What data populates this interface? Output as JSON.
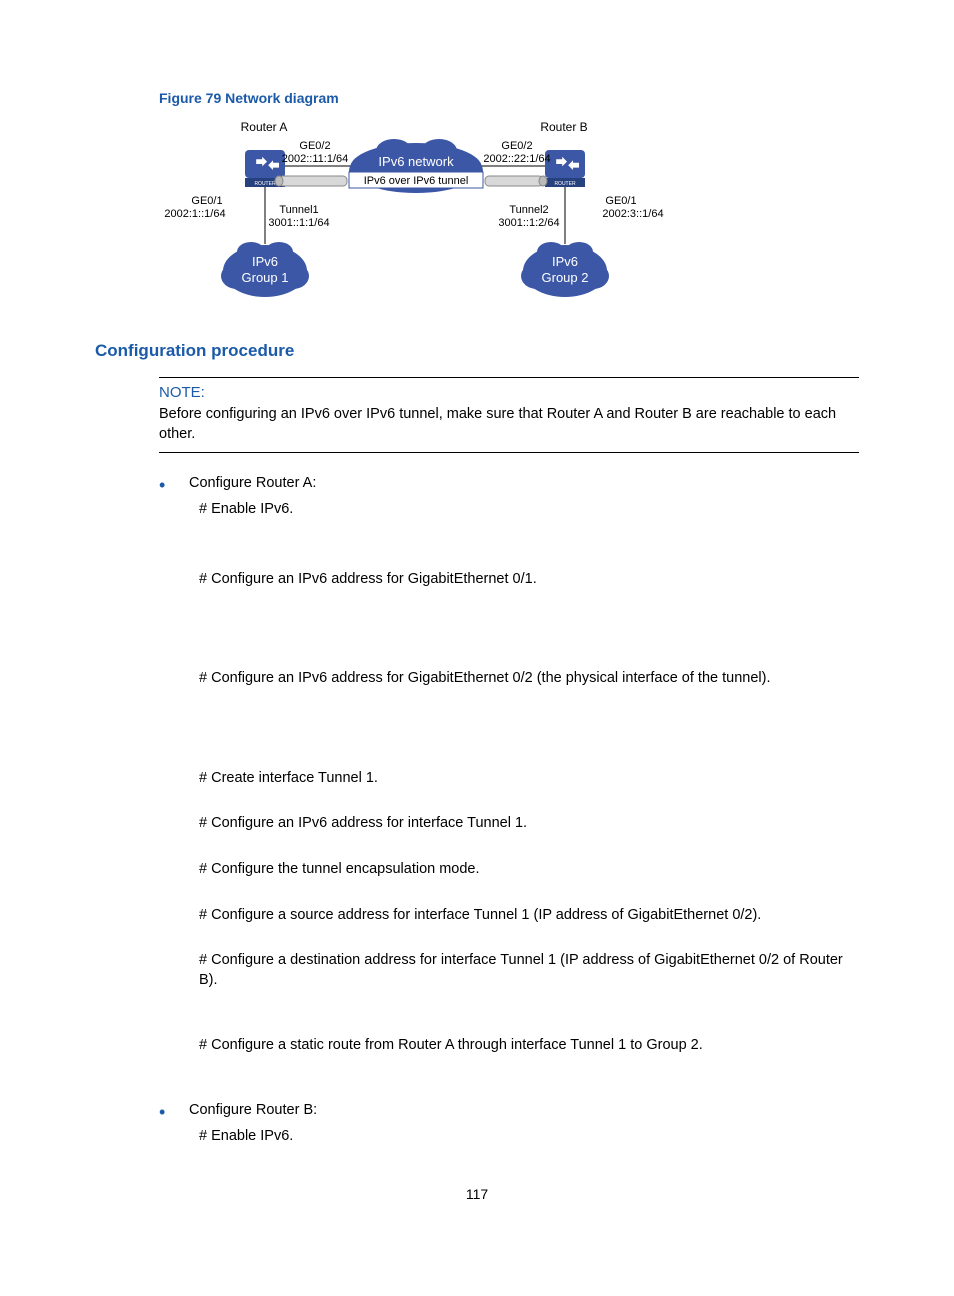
{
  "figure": {
    "caption": "Figure 79 Network diagram",
    "labels": {
      "routerA": "Router A",
      "routerB": "Router B",
      "ge02_left": "GE0/2",
      "ge02_right": "GE0/2",
      "addr_ge02_left": "2002::11:1/64",
      "addr_ge02_right": "2002::22:1/64",
      "cloud_top": "IPv6 network",
      "cloud_bottom": "IPv6 over IPv6 tunnel",
      "tunnel1": "Tunnel1",
      "tunnel2": "Tunnel2",
      "addr_tunnel1": "3001::1:1/64",
      "addr_tunnel2": "3001::1:2/64",
      "ge01_left": "GE0/1",
      "ge01_right": "GE0/1",
      "addr_ge01_left": "2002:1::1/64",
      "addr_ge01_right": "2002:3::1/64",
      "group1_top": "IPv6",
      "group1_bottom": "Group 1",
      "group2_top": "IPv6",
      "group2_bottom": "Group 2",
      "router_icon": "ROUTER"
    }
  },
  "section": "Configuration procedure",
  "note": {
    "label": "NOTE:",
    "text": "Before configuring an IPv6 over IPv6 tunnel, make sure that Router A and Router B are reachable to each other."
  },
  "configA": {
    "head": "Configure Router A:",
    "s0": "# Enable IPv6.",
    "s1": "# Configure an IPv6 address for GigabitEthernet 0/1.",
    "s2": "# Configure an IPv6 address for GigabitEthernet 0/2 (the physical interface of the tunnel).",
    "s3": "# Create interface Tunnel 1.",
    "s4": "# Configure an IPv6 address for interface Tunnel 1.",
    "s5": "# Configure the tunnel encapsulation mode.",
    "s6": "# Configure a source address for interface Tunnel 1 (IP address of GigabitEthernet 0/2).",
    "s7": "# Configure a destination address for interface Tunnel 1 (IP address of GigabitEthernet 0/2 of Router B).",
    "s8": "# Configure a static route from Router A through interface Tunnel 1 to Group 2."
  },
  "configB": {
    "head": "Configure Router B:",
    "s0": "# Enable IPv6."
  },
  "pageNumber": "117"
}
